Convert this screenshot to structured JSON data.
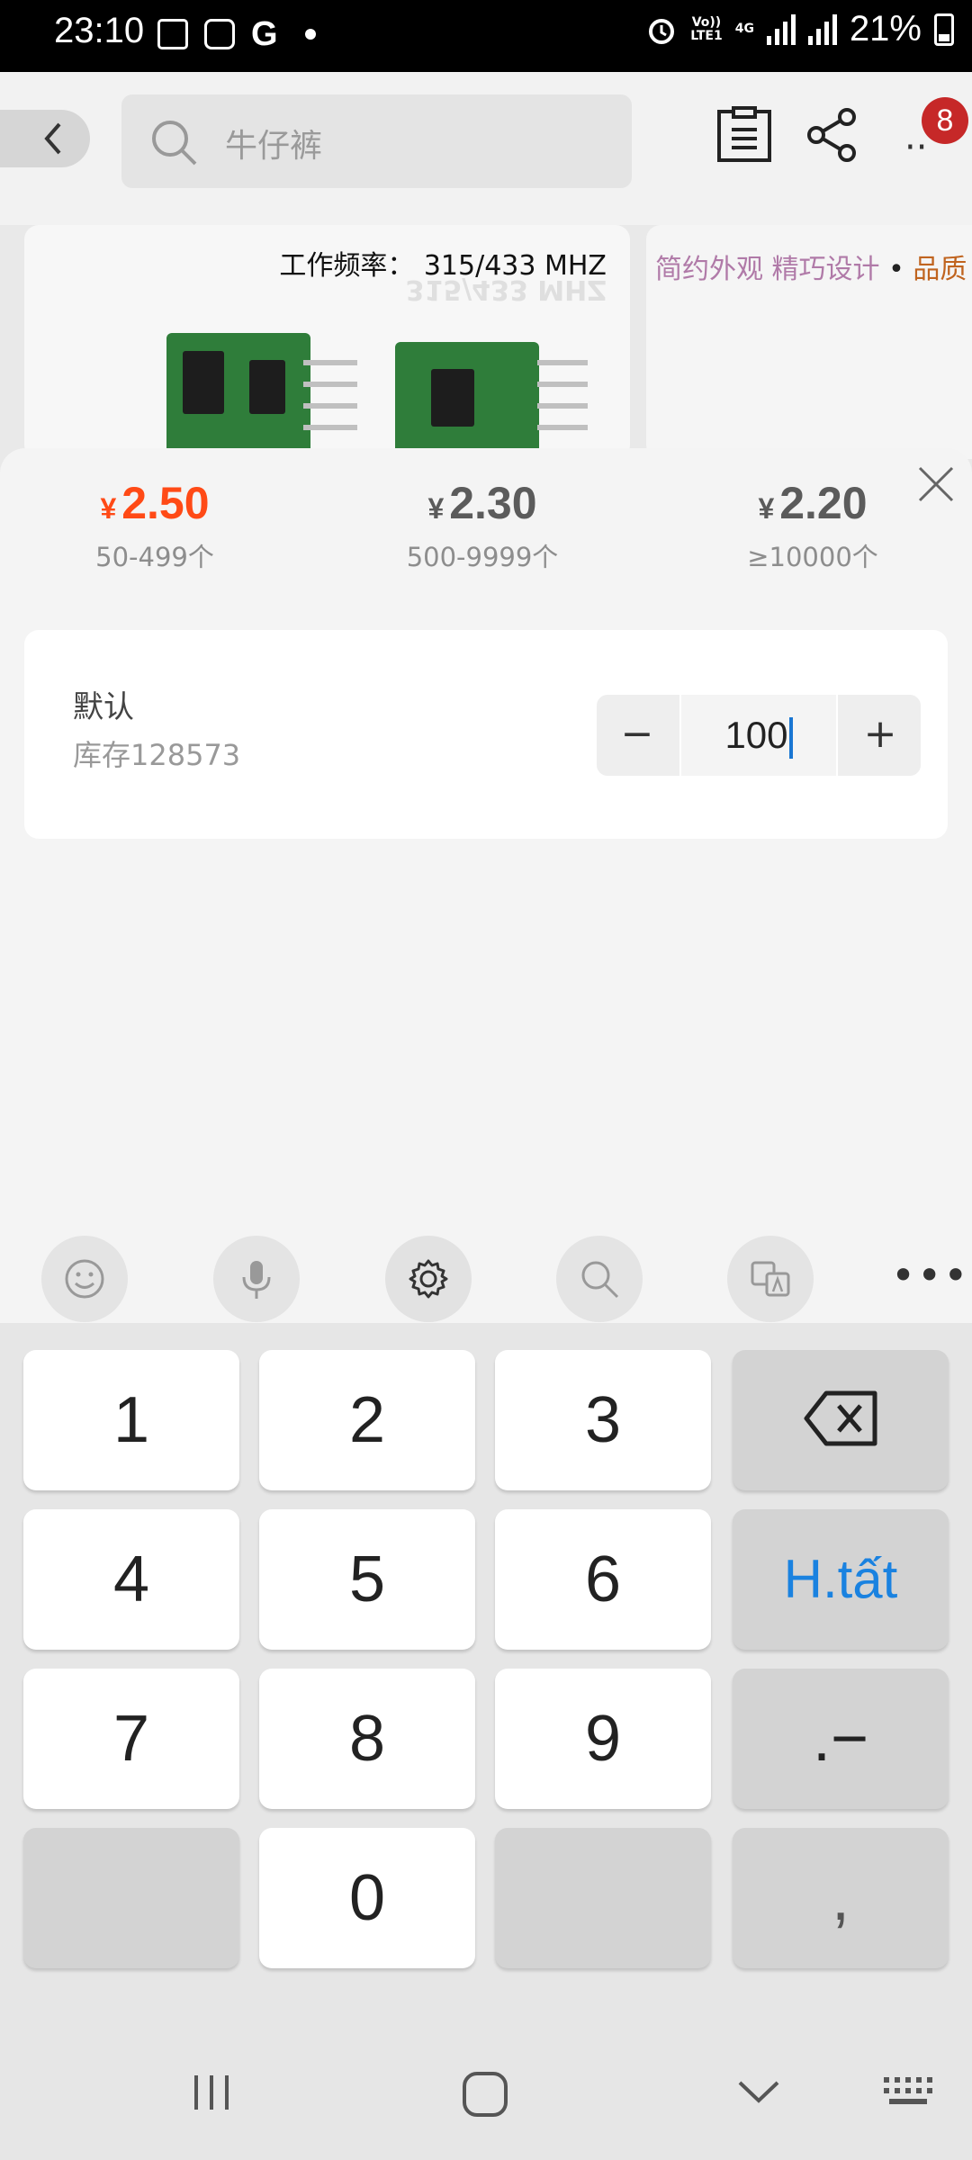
{
  "status_bar": {
    "time": "23:10",
    "g_label": "G",
    "volte": "Vo))",
    "lte": "LTE1",
    "net": "4G",
    "battery": "21%"
  },
  "header": {
    "search_placeholder": "牛仔裤",
    "cart_badge": "8"
  },
  "background_cards": {
    "card1_label": "工作频率：",
    "card1_value": "315/433 MHZ",
    "card2_label_a": "简约外观",
    "card2_label_b": "精巧设计",
    "card2_label_c": "品质"
  },
  "price_tiers": [
    {
      "currency": "¥",
      "price": "2.50",
      "range": "50-499个",
      "active": true
    },
    {
      "currency": "¥",
      "price": "2.30",
      "range": "500-9999个",
      "active": false
    },
    {
      "currency": "¥",
      "price": "2.20",
      "range": "≥10000个",
      "active": false
    }
  ],
  "option": {
    "name": "默认",
    "stock": "库存128573",
    "quantity": "100",
    "minus": "−",
    "plus": "+"
  },
  "keyboard": {
    "toolbar": [
      "emoji-icon",
      "mic-icon",
      "settings-icon",
      "search-icon",
      "translate-icon"
    ],
    "more": "•••",
    "keys": {
      "k1": "1",
      "k2": "2",
      "k3": "3",
      "k4": "4",
      "k5": "5",
      "k6": "6",
      "k7": "7",
      "k8": "8",
      "k9": "9",
      "k0": "0",
      "done": "H.tất",
      "dot_dash": ".−",
      "comma": ","
    }
  },
  "colors": {
    "accent_price": "#ff4a16",
    "done_key": "#1a82e0",
    "badge": "#c62828"
  }
}
